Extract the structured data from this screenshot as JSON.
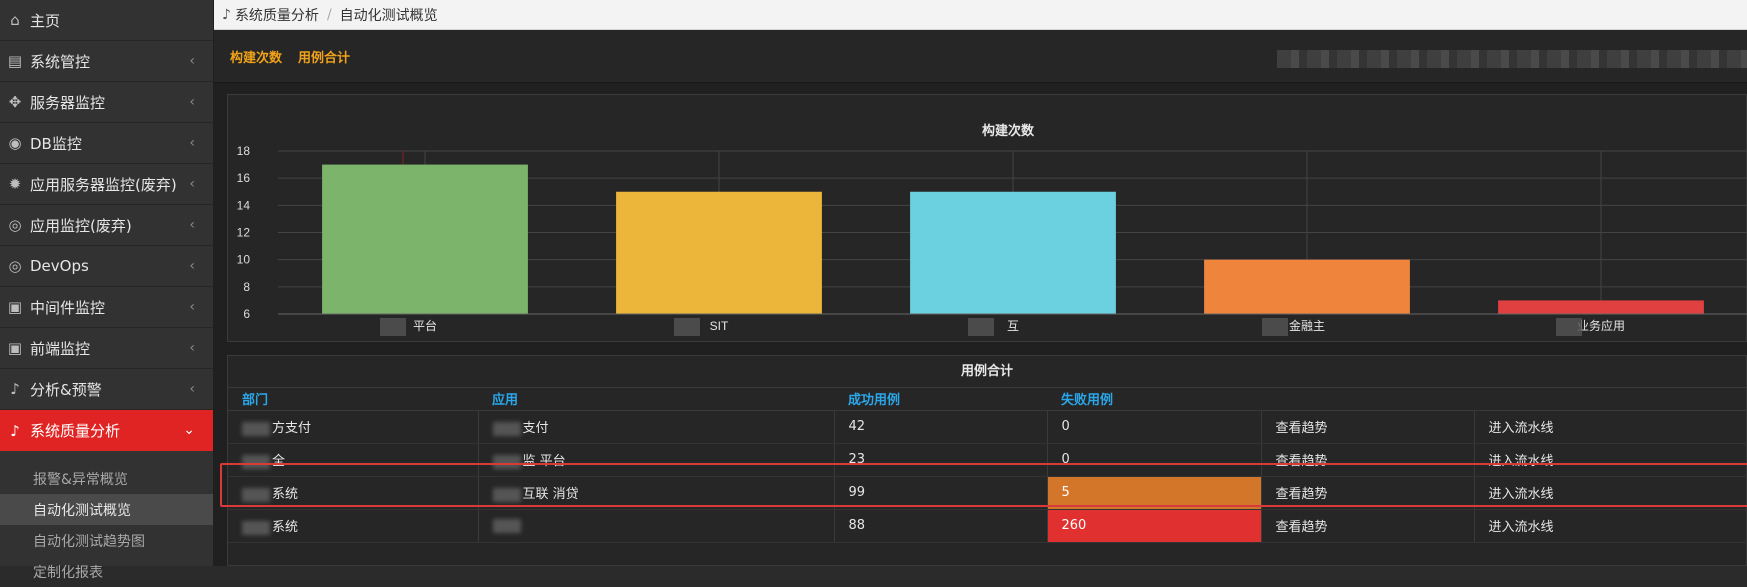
{
  "breadcrumb": {
    "parent": "系统质量分析",
    "current": "自动化测试概览"
  },
  "sidebar": {
    "items": [
      {
        "label": "主页",
        "icon": "home-icon",
        "glyph": "⌂",
        "chevron": false
      },
      {
        "label": "系统管控",
        "icon": "sliders-icon",
        "glyph": "▤",
        "chevron": true
      },
      {
        "label": "服务器监控",
        "icon": "crosshair-icon",
        "glyph": "✥",
        "chevron": true
      },
      {
        "label": "DB监控",
        "icon": "database-icon",
        "glyph": "◉",
        "chevron": true
      },
      {
        "label": "应用服务器监控(废弃)",
        "icon": "gear-icon",
        "glyph": "✹",
        "chevron": true
      },
      {
        "label": "应用监控(废弃)",
        "icon": "eye-icon",
        "glyph": "◎",
        "chevron": true
      },
      {
        "label": "DevOps",
        "icon": "eye-icon",
        "glyph": "◎",
        "chevron": true
      },
      {
        "label": "中间件监控",
        "icon": "briefcase-icon",
        "glyph": "▣",
        "chevron": true
      },
      {
        "label": "前端监控",
        "icon": "briefcase-icon",
        "glyph": "▣",
        "chevron": true
      },
      {
        "label": "分析&预警",
        "icon": "bell-icon",
        "glyph": "♪",
        "chevron": true
      }
    ],
    "active_item": {
      "label": "系统质量分析",
      "icon": "bell-icon",
      "glyph": "♪"
    },
    "sub_items": [
      {
        "label": "报警&异常概览",
        "active": false
      },
      {
        "label": "自动化测试概览",
        "active": true
      },
      {
        "label": "自动化测试趋势图",
        "active": false
      },
      {
        "label": "定制化报表",
        "active": false
      }
    ]
  },
  "links": {
    "builds": "构建次数",
    "cases": "用例合计"
  },
  "chart_data": {
    "type": "bar",
    "title": "构建次数",
    "categories": [
      "平台",
      "SIT",
      "互",
      "金融主",
      "业务应用"
    ],
    "values": [
      17,
      15,
      15,
      10,
      7
    ],
    "colors": [
      "#7db46c",
      "#ecb63a",
      "#6bd0e0",
      "#ef843c",
      "#e04040"
    ],
    "ylim": [
      6,
      18
    ],
    "yticks": [
      6,
      8,
      10,
      12,
      14,
      16,
      18
    ],
    "grid": true
  },
  "table": {
    "title": "用例合计",
    "headers": [
      "部门",
      "应用",
      "成功用例",
      "失败用例",
      "",
      ""
    ],
    "rows": [
      {
        "dept": "方支付",
        "app": "支付",
        "success": "42",
        "fail": "0",
        "trend": "查看趋势",
        "pipeline": "进入流水线",
        "status": "ok"
      },
      {
        "dept": "全",
        "app": "监 平台",
        "success": "23",
        "fail": "0",
        "trend": "查看趋势",
        "pipeline": "进入流水线",
        "status": "ok"
      },
      {
        "dept": "系统",
        "app": "互联 消贷",
        "success": "99",
        "fail": "5",
        "trend": "查看趋势",
        "pipeline": "进入流水线",
        "status": "warn"
      },
      {
        "dept": "系统",
        "app": "",
        "success": "88",
        "fail": "260",
        "trend": "查看趋势",
        "pipeline": "进入流水线",
        "status": "error"
      }
    ]
  }
}
